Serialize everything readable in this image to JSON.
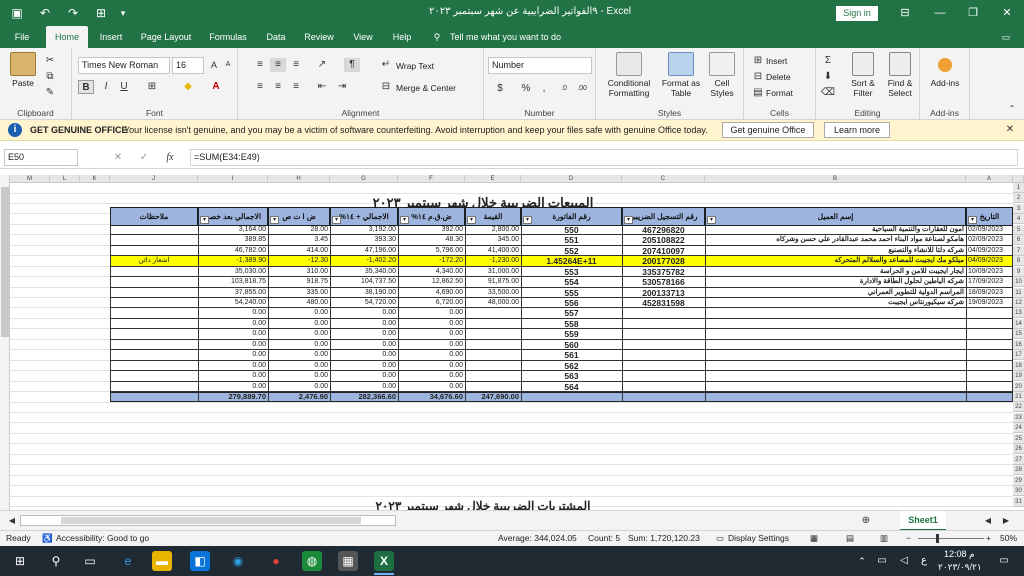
{
  "titlebar": {
    "title": "٩الفواتير الضرايبية عن شهر  سبتمبر ٢٠٢٣  -  Excel",
    "signin": "Sign in"
  },
  "tabs": [
    "File",
    "Home",
    "Insert",
    "Page Layout",
    "Formulas",
    "Data",
    "Review",
    "View",
    "Help"
  ],
  "tell_me": "Tell me what you want to do",
  "ribbon": {
    "paste": "Paste",
    "clipboard": "Clipboard",
    "font_name": "Times New Roman",
    "font_size": "16",
    "font": "Font",
    "wrap_text": "Wrap Text",
    "merge_center": "Merge & Center",
    "alignment": "Alignment",
    "number_format": "Number",
    "number": "Number",
    "conditional": "Conditional",
    "formatting": "Formatting",
    "format_as": "Format as",
    "table": "Table",
    "cell": "Cell",
    "styles_btn": "Styles",
    "styles": "Styles",
    "insert": "Insert",
    "delete": "Delete",
    "format": "Format",
    "cells": "Cells",
    "sort": "Sort &",
    "filter": "Filter",
    "find": "Find &",
    "select": "Select",
    "editing": "Editing",
    "addins": "Add-ins",
    "addins_group": "Add-ins"
  },
  "message": {
    "title": "GET GENUINE OFFICE",
    "text": "Your license isn't genuine, and you may be a victim of software counterfeiting. Avoid interruption and keep your files safe with genuine Office today.",
    "btn_genuine": "Get genuine Office",
    "btn_learn": "Learn more"
  },
  "formula_bar": {
    "name_box": "E50",
    "fx": "fx",
    "formula": "=SUM(E34:E49)"
  },
  "sheet": {
    "columns": [
      "A",
      "B",
      "C",
      "D",
      "E",
      "F",
      "G",
      "H",
      "I",
      "J",
      "K",
      "L",
      "M"
    ],
    "title": "المبيعات الضريبية خلال شهر  سبتمبر  ٢٠٢٣",
    "title2": "المشتريات الضريبية خلال شهر  سبتمبر  ٢٠٢٣",
    "headers": [
      "التاريخ",
      "إسم العميل",
      "رقم التسجيل الضريبي",
      "رقم الفاتورة",
      "القيمة",
      "ض.ق.م ١٤%",
      "الاجمالي + ١٤%",
      "ض ا ت ص",
      "الاجمالي بعد خصم",
      "ملاحظات"
    ],
    "rows": [
      {
        "date": "02/09/2023",
        "client": "امون للعقارات والتنمية السياحية",
        "tax": "467296820",
        "inv": "550",
        "val": "2,800.00",
        "vat": "392.00",
        "total": "3,192.00",
        "wht": "28.00",
        "net": "3,164.00",
        "note": ""
      },
      {
        "date": "02/09/2023",
        "client": "هامكو لصناعة مواد البناء  احمد محمد عبدالقادر علي حسن وشركاه",
        "tax": "205108822",
        "inv": "551",
        "val": "345.00",
        "vat": "48.30",
        "total": "393.30",
        "wht": "3.45",
        "net": "389.85",
        "note": ""
      },
      {
        "date": "04/09/2023",
        "client": "شركه دلتا للانشاء والتصنيع",
        "tax": "207410097",
        "inv": "552",
        "val": "41,400.00",
        "vat": "5,796.00",
        "total": "47,196.00",
        "wht": "414.00",
        "net": "46,782.00",
        "note": ""
      },
      {
        "date": "04/09/2023",
        "client": "ميلكو مك ايجيبت للمصاعد والسلالم المتحركه",
        "tax": "200177028",
        "inv": "1.45264E+11",
        "val": "-1,230.00",
        "vat": "-172.20",
        "total": "-1,402.20",
        "wht": "-12.30",
        "net": "-1,389.90",
        "note": "اشعار دائن",
        "highlight": true
      },
      {
        "date": "10/09/2023",
        "client": "ايجار ايجيبت للامن و الحراسة",
        "tax": "335375782",
        "inv": "553",
        "val": "31,000.00",
        "vat": "4,340.00",
        "total": "35,340.00",
        "wht": "310.00",
        "net": "35,030.00",
        "note": ""
      },
      {
        "date": "17/09/2023",
        "client": "شركه الياطين لحلول الطاقة والادارة",
        "tax": "530578166",
        "inv": "554",
        "val": "91,875.00",
        "vat": "12,862.50",
        "total": "104,737.50",
        "wht": "918.75",
        "net": "103,818.75",
        "note": ""
      },
      {
        "date": "18/09/2023",
        "client": "المراسم الدولية للتطوير العمراني",
        "tax": "200133713",
        "inv": "555",
        "val": "33,500.00",
        "vat": "4,690.00",
        "total": "38,190.00",
        "wht": "335.00",
        "net": "37,855.00",
        "note": ""
      },
      {
        "date": "19/09/2023",
        "client": "شركه سيكيورنتاس ايجيبت",
        "tax": "452831598",
        "inv": "556",
        "val": "48,000.00",
        "vat": "6,720.00",
        "total": "54,720.00",
        "wht": "480.00",
        "net": "54,240.00",
        "note": ""
      }
    ],
    "empty_invoices": [
      "557",
      "558",
      "559",
      "560",
      "561",
      "562",
      "563",
      "564"
    ],
    "zero": "0.00",
    "totals": {
      "val": "247,690.00",
      "vat": "34,676.60",
      "total": "282,366.60",
      "wht": "2,476.90",
      "net": "279,889.70"
    },
    "row_numbers": [
      "1",
      "2",
      "3",
      "4",
      "5",
      "6",
      "7",
      "8",
      "9",
      "10",
      "11",
      "12",
      "13",
      "14",
      "15",
      "16",
      "17",
      "18",
      "19",
      "20",
      "21",
      "22",
      "23",
      "24",
      "25",
      "26",
      "27",
      "28",
      "29",
      "30",
      "31"
    ]
  },
  "sheet_tab": "Sheet1",
  "status": {
    "ready": "Ready",
    "accessibility": "Accessibility: Good to go",
    "average": "Average: 344,024.05",
    "count": "Count: 5",
    "sum": "Sum: 1,720,120.23",
    "display": "Display Settings",
    "zoom": "50%"
  },
  "taskbar": {
    "time": "12:08 م",
    "date": "٢٠٢٣/٠٩/٢١",
    "lang": "ع"
  }
}
